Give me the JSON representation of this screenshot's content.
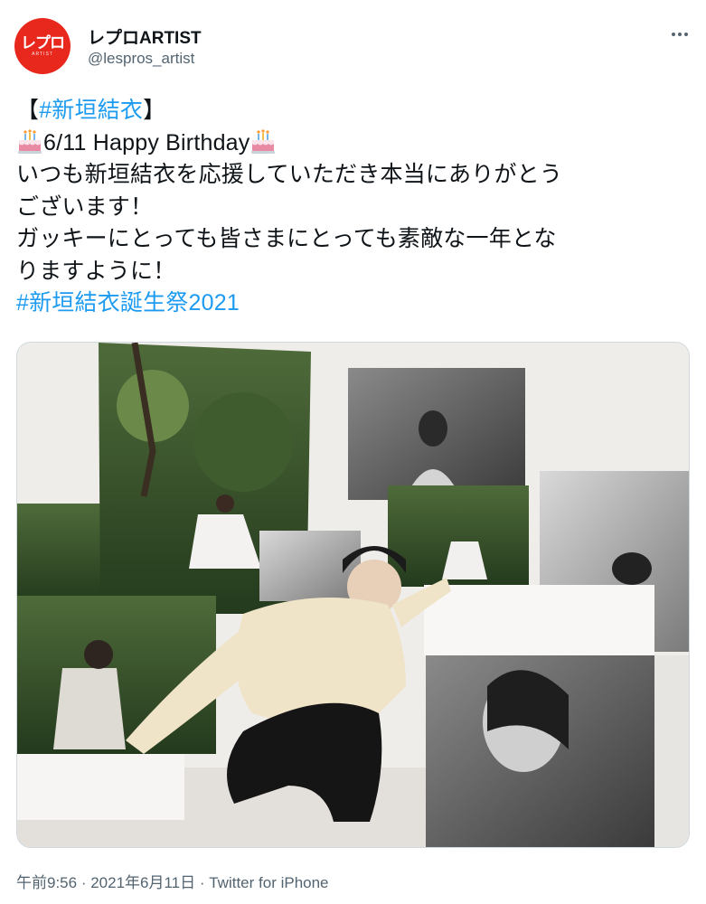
{
  "author": {
    "display_name": "レプロARTIST",
    "handle": "@lespros_artist",
    "avatar_text": "レプロ",
    "avatar_subtext": "ARTIST",
    "avatar_color": "#e8281d"
  },
  "tweet": {
    "bracket_open": "【",
    "hashtag_1": "#新垣結衣",
    "bracket_close": "】",
    "birthday_line": "6/11 Happy Birthday",
    "line_3": "いつも新垣結衣を応援していただき本当にありがとう",
    "line_4": "ございます！",
    "line_5": "ガッキーにとっても皆さまにとっても素敵な一年とな",
    "line_6": "りますように！",
    "hashtag_2": "#新垣結衣誕生祭2021",
    "emoji": "birthday-cake-icon"
  },
  "meta": {
    "time": "午前9:56",
    "separator_1": " · ",
    "date": "2021年6月11日",
    "separator_2": " · ",
    "source": "Twitter for iPhone"
  },
  "colors": {
    "link": "#1d9bf0",
    "text": "#0f1419",
    "secondary": "#536471"
  }
}
